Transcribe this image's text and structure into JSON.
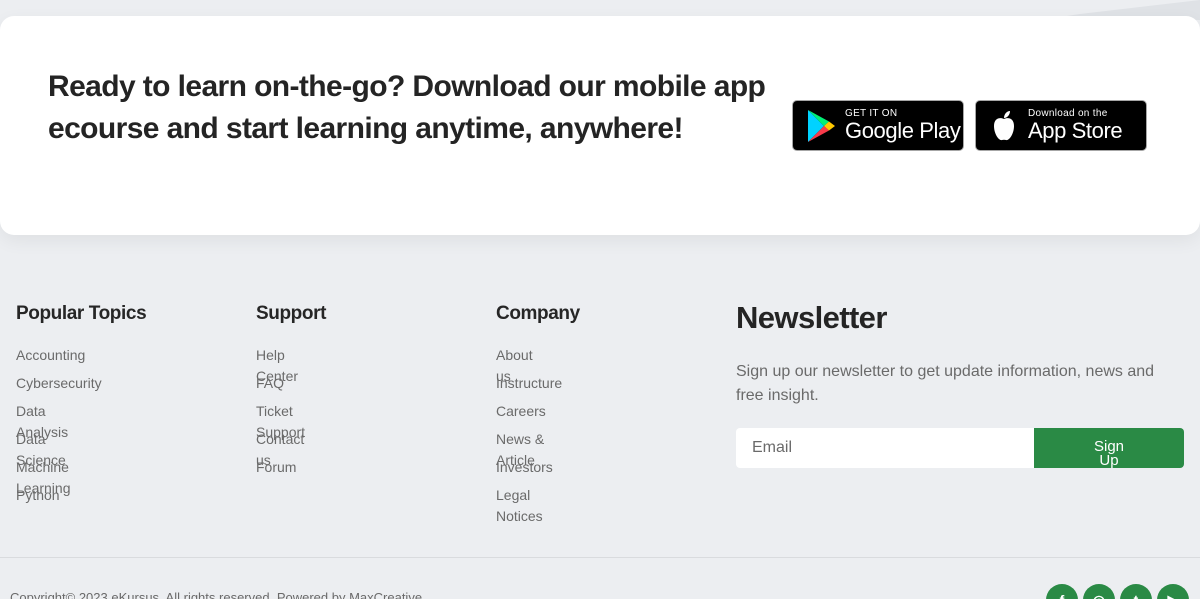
{
  "app_banner": {
    "title": "Ready to learn on-the-go? Download our mobile app ecourse and start learning anytime, anywhere!",
    "google_play": {
      "small": "GET IT ON",
      "big": "Google Play"
    },
    "app_store": {
      "small": "Download on the",
      "big": "App Store"
    }
  },
  "footer": {
    "columns": [
      {
        "title": "Popular Topics",
        "items": [
          "Accounting",
          "Cybersecurity",
          "Data Analysis",
          "Data Science",
          "Machine Learning",
          "Python"
        ]
      },
      {
        "title": "Support",
        "items": [
          "Help Center",
          "FAQ",
          "Ticket Support",
          "Contact us",
          "Forum"
        ]
      },
      {
        "title": "Company",
        "items": [
          "About us",
          "Instructure",
          "Careers",
          "News & Article",
          "Investors",
          "Legal Notices"
        ]
      }
    ],
    "newsletter": {
      "title": "Newsletter",
      "description": "Sign up our newsletter to get update information, news and free insight.",
      "email_placeholder": "Email",
      "button_label": "Sign Up"
    },
    "copyright": "Copyright© 2023 eKursus. All rights reserved. Powered by MaxCreative",
    "social": [
      {
        "icon": "facebook-icon",
        "glyph": "f"
      },
      {
        "icon": "instagram-icon",
        "glyph": "◎"
      },
      {
        "icon": "twitter-icon",
        "glyph": "t"
      },
      {
        "icon": "youtube-icon",
        "glyph": "▶"
      }
    ],
    "accent_color": "#2a8a45"
  }
}
